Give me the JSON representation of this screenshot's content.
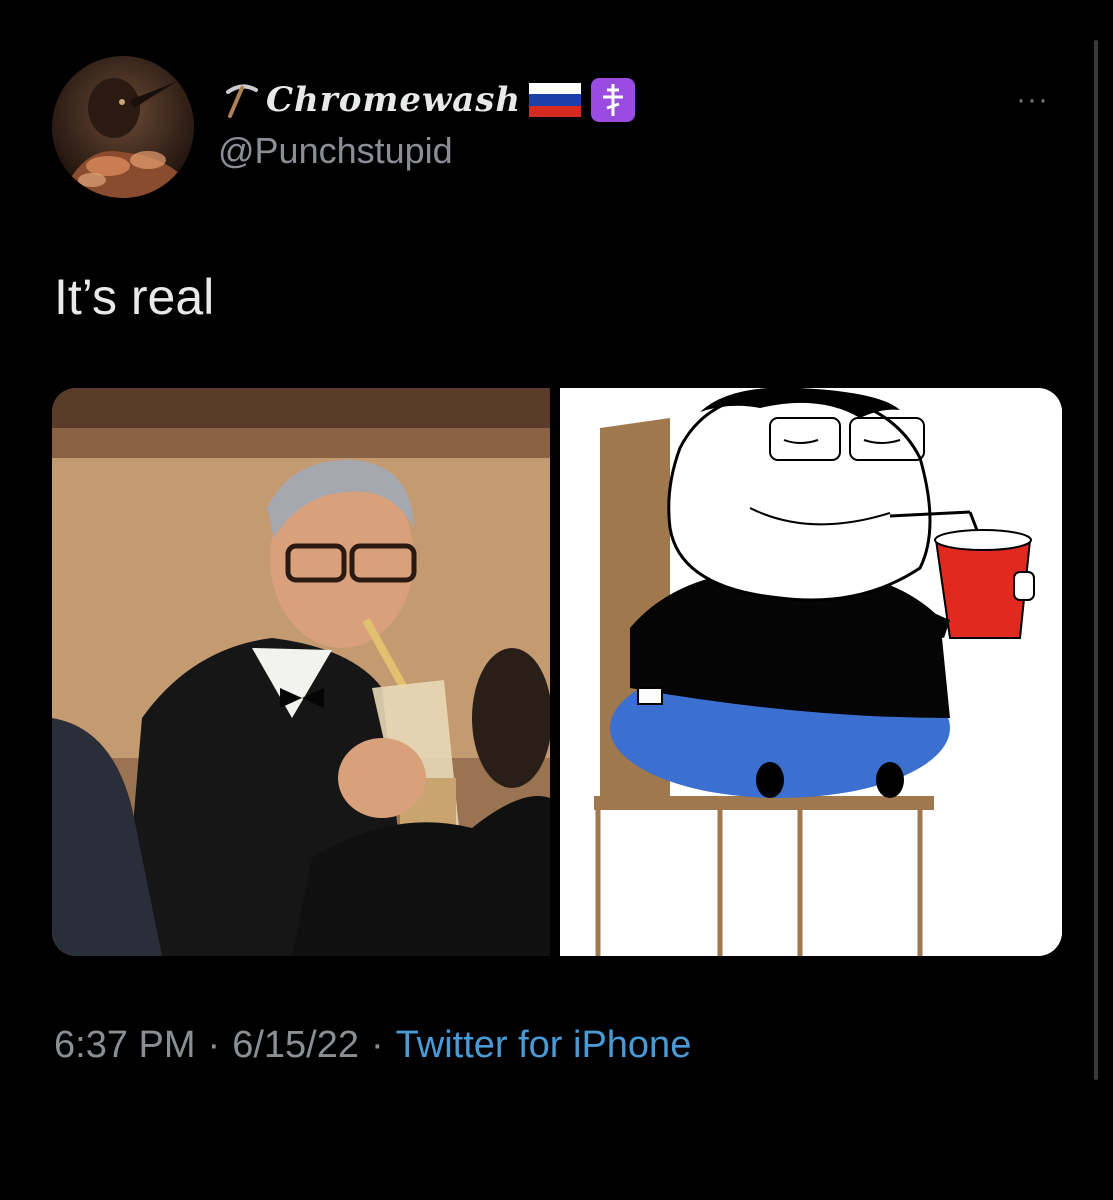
{
  "tweet": {
    "display_name": "Chromewash",
    "handle": "@Punchstupid",
    "more_label": "···",
    "text": "It’s real",
    "time": "6:37 PM",
    "date": "6/15/22",
    "separator": "·",
    "source": "Twitter for iPhone",
    "icons": {
      "avatar": "bird-avatar-icon",
      "name_prefix": "pickaxe-icon",
      "flag": "russia-flag-icon",
      "cross": "orthodox-cross-icon",
      "more": "more-icon"
    }
  },
  "colors": {
    "background": "#000000",
    "text": "#e7e9ea",
    "secondary": "#8b8f94",
    "link": "#4a9ad6",
    "cross_badge": "#9a4ce0",
    "flag": [
      "#ffffff",
      "#1c3fa8",
      "#d52b1e"
    ]
  }
}
